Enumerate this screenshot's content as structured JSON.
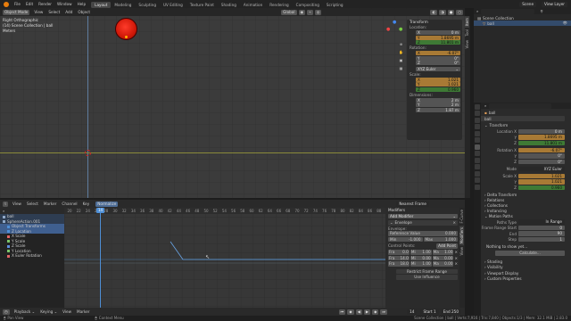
{
  "topbar": {
    "menus": [
      "File",
      "Edit",
      "Render",
      "Window",
      "Help"
    ],
    "workspaces": [
      "Layout",
      "Modeling",
      "Sculpting",
      "UV Editing",
      "Texture Paint",
      "Shading",
      "Animation",
      "Rendering",
      "Compositing",
      "Scripting"
    ],
    "active_workspace": "Layout",
    "scene": "Scene",
    "view_layer": "View Layer"
  },
  "viewport": {
    "mode": "Object Mode",
    "menus": [
      "View",
      "Select",
      "Add",
      "Object"
    ],
    "orientation": "Global",
    "info_lines": [
      "Right Orthographic",
      "(14) Scene Collection | ball",
      "Meters"
    ]
  },
  "npanel": {
    "section": "Transform",
    "location_label": "Location:",
    "location": [
      [
        "X",
        "0 m"
      ],
      [
        "Y",
        "1.8695 m"
      ],
      [
        "Z",
        "11.801 m"
      ]
    ],
    "rotation_label": "Rotation:",
    "rotation": [
      [
        "X",
        "-6.07°"
      ],
      [
        "Y",
        "0°"
      ],
      [
        "Z",
        "0°"
      ]
    ],
    "rotation_mode": "XYZ Euler",
    "scale_label": "Scale:",
    "scale": [
      [
        "X",
        "1.021"
      ],
      [
        "Y",
        "1.021"
      ],
      [
        "Z",
        "0.960"
      ]
    ],
    "dimensions_label": "Dimensions:",
    "dimensions": [
      [
        "X",
        "2 m"
      ],
      [
        "Y",
        "2 m"
      ],
      [
        "Z",
        "1.87 m"
      ]
    ],
    "tabs": [
      "Item",
      "Tool",
      "View"
    ]
  },
  "outliner": {
    "title": "Scene Collection",
    "items": [
      "ball"
    ]
  },
  "properties": {
    "object_name": "ball",
    "sub_name": "ball",
    "transform_title": "Transform",
    "location_label": "Location X",
    "location": [
      "0 m",
      "1.8695 m",
      "11.801 m"
    ],
    "rotation_label": "Rotation X",
    "rotation": [
      "-6.07°",
      "0°",
      "0°"
    ],
    "mode_label": "Mode",
    "mode": "XYZ Euler",
    "scale_label": "Scale X",
    "scale": [
      "1.021",
      "1.021",
      "0.960"
    ],
    "delta_transform": "Delta Transform",
    "relations": "Relations",
    "collections": "Collections",
    "instancing": "Instancing",
    "motion_paths": "Motion Paths",
    "paths_type_label": "Paths Type",
    "paths_type": "In Range",
    "frame_range_start_label": "Frame Range Start",
    "frame_range_start": "0",
    "end_label": "End",
    "end": "90",
    "step_label": "Step",
    "step": "1",
    "nothing_to_show": "Nothing to show yet...",
    "calculate_button": "Calculate...",
    "visibility": "Visibility",
    "viewport_display": "Viewport Display",
    "custom_properties": "Custom Properties",
    "shading": "Shading"
  },
  "graph_editor": {
    "menus": [
      "View",
      "Select",
      "Marker",
      "Channel",
      "Key"
    ],
    "normalize": "Normalize",
    "interpolation": "Nearest Frame",
    "ruler_ticks": [
      "20",
      "22",
      "24",
      "26",
      "28",
      "30",
      "32",
      "34",
      "36",
      "38",
      "40",
      "42",
      "44",
      "46",
      "48",
      "50",
      "52",
      "54",
      "56",
      "58",
      "60",
      "62",
      "64",
      "66",
      "68",
      "70",
      "72",
      "74",
      "76",
      "78",
      "80",
      "82",
      "84",
      "86",
      "88"
    ],
    "current_frame": "14",
    "channels": [
      {
        "label": "ball",
        "color": "#8fa8c8",
        "kind": "obj"
      },
      {
        "label": "SphereAction.001",
        "color": "#8fa8c8",
        "kind": "obj"
      },
      {
        "label": "Object Transforms",
        "color": "#4e8fd6",
        "kind": "hl"
      },
      {
        "label": "Z Location",
        "color": "#4e8fd6",
        "kind": "hl"
      },
      {
        "label": "X Scale",
        "color": "#e06666",
        "kind": ""
      },
      {
        "label": "Y Scale",
        "color": "#7cc46a",
        "kind": ""
      },
      {
        "label": "Z Scale",
        "color": "#5f8fe0",
        "kind": ""
      },
      {
        "label": "Y Location",
        "color": "#7cc46a",
        "kind": ""
      },
      {
        "label": "X Euler Rotation",
        "color": "#e06666",
        "kind": ""
      }
    ],
    "side": {
      "title": "Modifiers",
      "add_modifier": "Add Modifier",
      "modifier_name": "Envelope",
      "envelope_label": "Envelope:",
      "reference_label": "Reference Value",
      "reference_value": "0.000",
      "min_label": "Min",
      "min_value": "-1.000",
      "max_label": "Max",
      "max_value": "1.000",
      "control_points": "Control Points:",
      "add_point": "Add Point",
      "points": [
        [
          "Fra",
          "0.0",
          "Mi",
          "1.00",
          "Ma",
          "1.00"
        ],
        [
          "Fra",
          "14.0",
          "Mi",
          "0.00",
          "Ma",
          "0.00"
        ],
        [
          "Fra",
          "18.0",
          "Mi",
          "1.00",
          "Ma",
          "0.00"
        ]
      ],
      "restrict_frame_range": "Restrict Frame Range",
      "use_influence": "Use Influence",
      "tabs": [
        "F-Curve",
        "Modifiers",
        "View"
      ]
    }
  },
  "footer": {
    "menus": [
      "Playback",
      "Keying",
      "View",
      "Marker"
    ],
    "frame": "14",
    "start_label": "Start",
    "start": "1",
    "end_label": "End",
    "end": "250"
  },
  "status": {
    "left": "Pan View",
    "middle": "Context Menu",
    "right": "Scene Collection | ball | Verts:7,916 | Tris:7,840 | Objects:1/3 | Mem: 32.1 MiB | 2.83.0"
  },
  "colors": {
    "accent_blue": "#4e8fd6",
    "keyed_orange": "#a87a35",
    "animated_green": "#3e7a35",
    "ball_red": "#e02010"
  }
}
